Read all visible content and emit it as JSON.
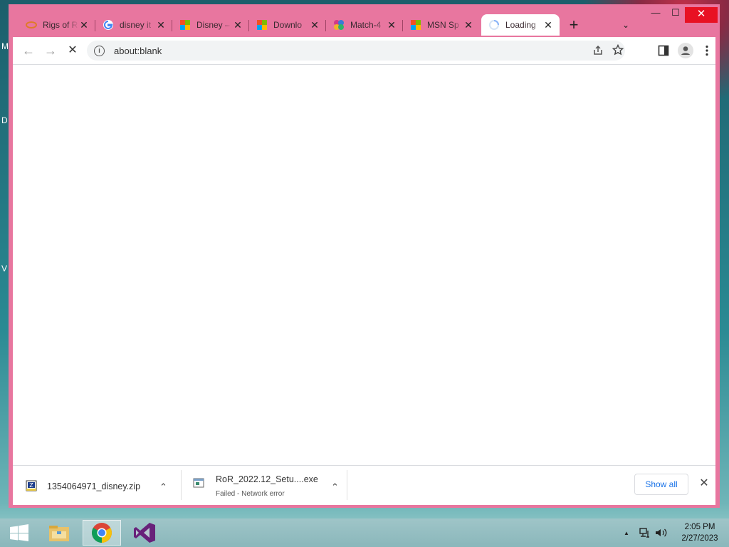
{
  "desktop": {
    "letters": [
      "M",
      "D",
      "V"
    ]
  },
  "browser": {
    "tabs": [
      {
        "title": "Rigs of R",
        "icon": "rigs-of-rods-favicon"
      },
      {
        "title": "disney it",
        "icon": "google-favicon"
      },
      {
        "title": "Disney –",
        "icon": "msn-favicon"
      },
      {
        "title": "Downlo",
        "icon": "msn-favicon"
      },
      {
        "title": "Match-4",
        "icon": "match-game-favicon"
      },
      {
        "title": "MSN Sp",
        "icon": "msn-favicon"
      },
      {
        "title": "Loading",
        "icon": "loading-spinner-icon",
        "active": true
      }
    ],
    "close_glyph": "✕",
    "new_tab_glyph": "+",
    "tab_search_glyph": "⌄",
    "window_controls": {
      "minimize": "—",
      "maximize": "☐",
      "close": "✕"
    },
    "toolbar": {
      "back": "←",
      "forward": "→",
      "stop": "✕",
      "url": "about:blank"
    }
  },
  "downloads": {
    "items": [
      {
        "name": "1354064971_disney.zip",
        "status": ""
      },
      {
        "name": "RoR_2022.12_Setu....exe",
        "status": "Failed - Network error"
      }
    ],
    "show_all": "Show all",
    "close_glyph": "✕",
    "chevron": "⌃"
  },
  "taskbar": {
    "apps": [
      "windows-start",
      "file-explorer",
      "chrome",
      "visual-studio"
    ],
    "clock": {
      "time": "2:05 PM",
      "date": "2/27/2023"
    },
    "tray_up": "▲"
  }
}
